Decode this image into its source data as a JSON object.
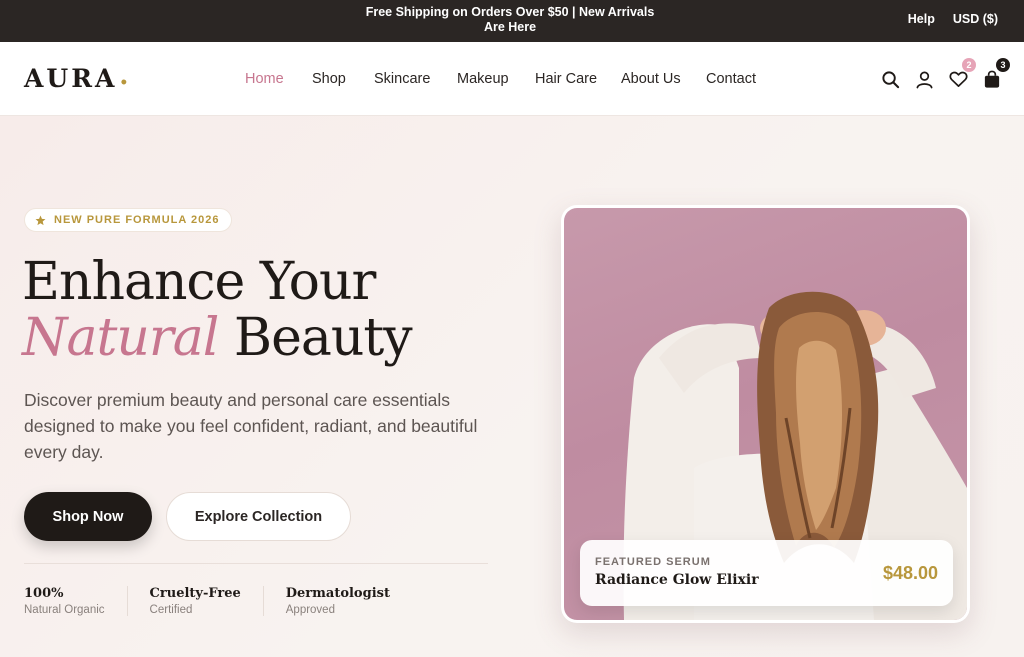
{
  "announcement": {
    "message": "Free Shipping on Orders Over $50 | New Arrivals Are Here",
    "help_link": "Help",
    "currency": "USD ($)"
  },
  "header": {
    "logo": "AURA",
    "logo_dot": "•",
    "nav": [
      {
        "label": "Home",
        "active": true
      },
      {
        "label": "Shop",
        "active": false
      },
      {
        "label": "Skincare",
        "active": false
      },
      {
        "label": "Makeup",
        "active": false
      },
      {
        "label": "Hair Care",
        "active": false
      },
      {
        "label": "About Us",
        "active": false
      },
      {
        "label": "Contact",
        "active": false
      }
    ],
    "icons": {
      "search": "search-icon",
      "account": "user-icon",
      "wishlist": "heart-icon",
      "cart": "bag-icon"
    },
    "wishlist_count": "2",
    "cart_count": "3"
  },
  "hero": {
    "tag": "NEW PURE FORMULA 2026",
    "title_line1": "Enhance Your",
    "title_italic": "Natural",
    "title_line2_rest": "Beauty",
    "description": "Discover premium beauty and personal care essentials designed to make you feel confident, radiant, and beautiful every day.",
    "cta_primary": "Shop Now",
    "cta_secondary": "Explore Collection",
    "stats": [
      {
        "top": "100%",
        "bottom": "Natural Organic"
      },
      {
        "top": "Cruelty-Free",
        "bottom": "Certified"
      },
      {
        "top": "Dermatologist",
        "bottom": "Approved"
      }
    ]
  },
  "featured": {
    "tag": "FEATURED SERUM",
    "name": "Radiance Glow Elixir",
    "price": "$48.00"
  },
  "colors": {
    "accent_pink": "#c7768f",
    "gold": "#b8973c",
    "dark": "#1f1a17"
  }
}
